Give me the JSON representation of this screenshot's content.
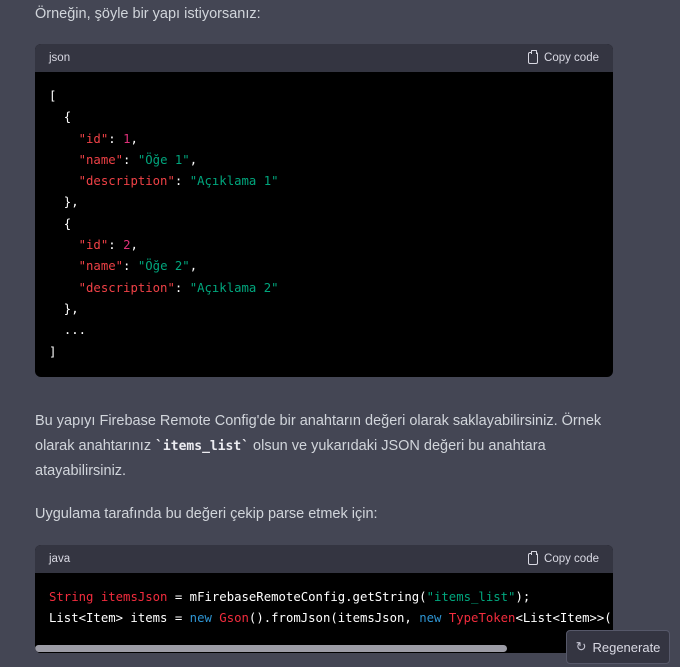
{
  "intro_text": "Örneğin, şöyle bir yapı istiyorsanız:",
  "json_block": {
    "language": "json",
    "copy_label": "Copy code",
    "items": [
      {
        "id_key": "\"id\"",
        "id_val": "1",
        "name_key": "\"name\"",
        "name_val": "\"Öğe 1\"",
        "desc_key": "\"description\"",
        "desc_val": "\"Açıklama 1\""
      },
      {
        "id_key": "\"id\"",
        "id_val": "2",
        "name_key": "\"name\"",
        "name_val": "\"Öğe 2\"",
        "desc_key": "\"description\"",
        "desc_val": "\"Açıklama 2\""
      }
    ],
    "ellipsis": "..."
  },
  "para1": {
    "before": "Bu yapıyı Firebase Remote Config'de bir anahtarın değeri olarak saklayabilirsiniz. Örnek olarak anahtarınız ",
    "code": "`items_list`",
    "after": " olsun ve yukarıdaki JSON değeri bu anahtara atayabilirsiniz."
  },
  "para2": "Uygulama tarafında bu değeri çekip parse etmek için:",
  "java_block": {
    "language": "java",
    "copy_label": "Copy code",
    "line1": {
      "type": "String",
      "var": "itemsJson",
      "rest1": " = mFirebaseRemoteConfig.getString(",
      "str": "\"items_list\"",
      "rest2": ");"
    },
    "line2": {
      "a": "List<Item> items = ",
      "kw1": "new",
      "ty1": "Gson",
      "b": "().fromJson(itemsJson, ",
      "kw2": "new",
      "ty2": "TypeToken",
      "c": "<List<Item>>("
    }
  },
  "regenerate_label": "Regenerate"
}
